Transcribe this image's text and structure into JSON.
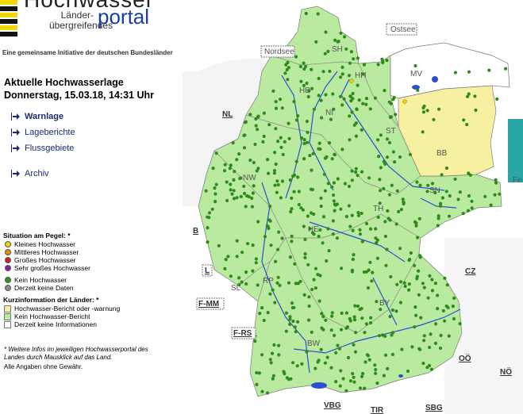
{
  "logo": {
    "title": "Hochwasser",
    "subtitle_line1": "Länder-",
    "subtitle_line2": "übergreifendes",
    "portal_word": "portal",
    "tagline": "Eine gemeinsame Initiative der deutschen Bundesländer"
  },
  "status": {
    "heading": "Aktuelle Hochwasserlage",
    "datetime": "Donnerstag, 15.03.18, 14:31 Uhr"
  },
  "nav": [
    {
      "label": "Warnlage"
    },
    {
      "label": "Lageberichte"
    },
    {
      "label": "Flussgebiete"
    },
    {
      "label": "Archiv"
    }
  ],
  "legend": {
    "pegel_heading": "Situation am Pegel: *",
    "pegel_items": [
      {
        "label": "Kleines Hochwasser",
        "color": "#f5d400"
      },
      {
        "label": "Mittleres Hochwasser",
        "color": "#f08a00"
      },
      {
        "label": "Großes Hochwasser",
        "color": "#d21f1f"
      },
      {
        "label": "Sehr großes Hochwasser",
        "color": "#8a1ca0"
      }
    ],
    "normal_items": [
      {
        "label": "Kein Hochwasser",
        "color": "#2e9a1a"
      },
      {
        "label": "Derzeit keine Daten",
        "color": "#8c8c8c"
      }
    ],
    "laender_heading": "Kurzinformation der Länder: *",
    "laender_items": [
      {
        "label": "Hochwasser-Bericht oder -warnung",
        "color": "#f7f0a0"
      },
      {
        "label": "Kein Hochwasser-Bericht",
        "color": "#b9eaa0"
      },
      {
        "label": "Derzeit keine Informationen",
        "color": "#ffffff"
      }
    ],
    "footnote": "* Weitere Infos im jeweiligen Hochwasserportal des Landes durch Mausklick auf das Land.",
    "disclaimer": "Alle Angaben ohne Gewähr."
  },
  "map": {
    "colors": {
      "green": "#b9eaa0",
      "yellow": "#f7f0a0",
      "white": "#ffffff",
      "river": "#2b4fd1",
      "dot": "#2e8b1a"
    },
    "states": [
      "SH",
      "HH",
      "MV",
      "HB",
      "NI",
      "ST",
      "BB",
      "NW",
      "SN",
      "TH",
      "HE",
      "RP",
      "SL",
      "BY",
      "BW"
    ],
    "countries": [
      "NL",
      "B",
      "L",
      "F-MM",
      "F-RS",
      "CZ",
      "OÖ",
      "NÖ",
      "VBG",
      "TIR",
      "SBG"
    ],
    "seas": [
      "Nordsee",
      "Ostsee"
    ],
    "side_label": "Fe"
  }
}
